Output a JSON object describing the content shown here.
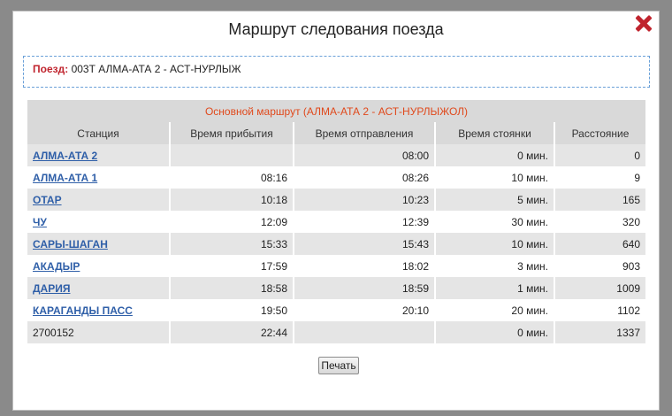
{
  "dialog": {
    "title": "Маршрут следования поезда",
    "close_icon": "close-x-icon"
  },
  "train": {
    "label": "Поезд:",
    "value": "003Т АЛМА-АТА 2 - АСТ-НУРЛЫЖ"
  },
  "route_table": {
    "route_title": "Основной маршрут (АЛМА-АТА 2 - АСТ-НУРЛЫЖОЛ)",
    "columns": [
      "Станция",
      "Время прибытия",
      "Время отправления",
      "Время стоянки",
      "Расстояние"
    ],
    "rows": [
      {
        "station": "АЛМА-АТА 2",
        "link": true,
        "arrival": "",
        "departure": "08:00",
        "stop": "0 мин.",
        "distance": "0"
      },
      {
        "station": "АЛМА-АТА 1",
        "link": true,
        "arrival": "08:16",
        "departure": "08:26",
        "stop": "10 мин.",
        "distance": "9"
      },
      {
        "station": "ОТАР",
        "link": true,
        "arrival": "10:18",
        "departure": "10:23",
        "stop": "5 мин.",
        "distance": "165"
      },
      {
        "station": "ЧУ",
        "link": true,
        "arrival": "12:09",
        "departure": "12:39",
        "stop": "30 мин.",
        "distance": "320"
      },
      {
        "station": "САРЫ-ШАГАН",
        "link": true,
        "arrival": "15:33",
        "departure": "15:43",
        "stop": "10 мин.",
        "distance": "640"
      },
      {
        "station": "АКАДЫР",
        "link": true,
        "arrival": "17:59",
        "departure": "18:02",
        "stop": "3 мин.",
        "distance": "903"
      },
      {
        "station": "ДАРИЯ",
        "link": true,
        "arrival": "18:58",
        "departure": "18:59",
        "stop": "1 мин.",
        "distance": "1009"
      },
      {
        "station": "КАРАГАНДЫ ПАСС",
        "link": true,
        "arrival": "19:50",
        "departure": "20:10",
        "stop": "20 мин.",
        "distance": "1102"
      },
      {
        "station": "2700152",
        "link": false,
        "arrival": "22:44",
        "departure": "",
        "stop": "0 мин.",
        "distance": "1337"
      }
    ]
  },
  "print_button": {
    "label": "Печать"
  },
  "colors": {
    "accent_red": "#c0242e",
    "route_title": "#e0491c",
    "link_blue": "#2f5fa8",
    "dashed_border": "#6aa0d8",
    "row_alt": "#e5e5e5",
    "header_bg": "#d9d9d9"
  }
}
